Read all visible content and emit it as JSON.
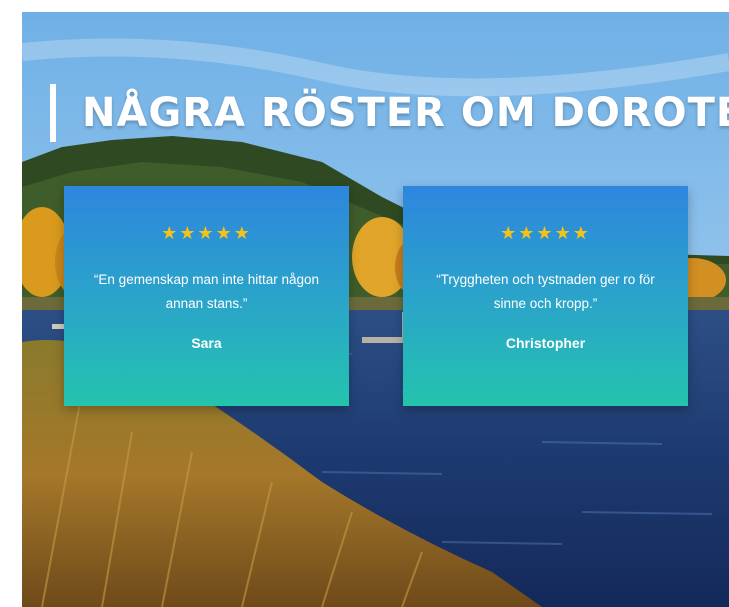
{
  "section": {
    "title": "NÅGRA RÖSTER OM DOROTEA"
  },
  "testimonials": [
    {
      "stars": "★★★★★",
      "rating": 5,
      "quote": "“En gemenskap man inte hittar någon annan stans.”",
      "author": "Sara"
    },
    {
      "stars": "★★★★★",
      "rating": 5,
      "quote": "“Tryggheten och tystnaden ger ro för sinne och kropp.”",
      "author": "Christopher"
    }
  ],
  "colors": {
    "star": "#f6c21a",
    "card_top": "#2e86de",
    "card_bottom": "#24c4ad",
    "text": "#ffffff"
  }
}
